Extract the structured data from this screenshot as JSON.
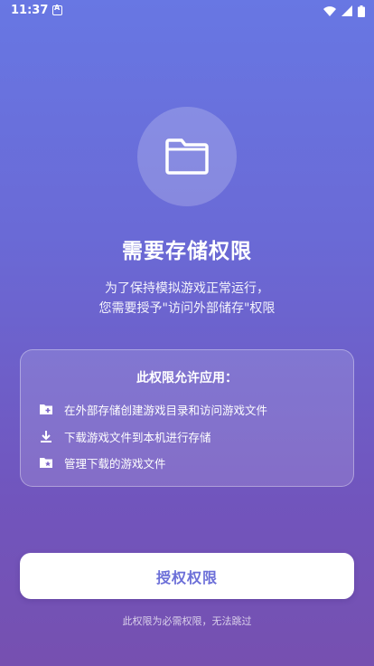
{
  "status_bar": {
    "time": "11:37",
    "icons": [
      "notification-a-icon",
      "wifi-icon",
      "signal-icon",
      "battery-icon"
    ]
  },
  "main": {
    "icon": "folder-icon",
    "title": "需要存储权限",
    "description_lines": [
      "为了保持模拟游戏正常运行，",
      "您需要授予\"访问外部储存\"权限"
    ]
  },
  "permissions_card": {
    "title": "此权限允许应用：",
    "items": [
      {
        "icon": "folder-add-icon",
        "label": "在外部存储创建游戏目录和访问游戏文件"
      },
      {
        "icon": "download-icon",
        "label": "下载游戏文件到本机进行存储"
      },
      {
        "icon": "folder-star-icon",
        "label": "管理下载的游戏文件"
      }
    ]
  },
  "actions": {
    "grant_label": "授权权限",
    "footer_note": "此权限为必需权限，无法跳过"
  },
  "colors": {
    "gradient_top": "#6877e3",
    "gradient_bottom": "#7650b0",
    "button_text": "#6c6fd8"
  }
}
